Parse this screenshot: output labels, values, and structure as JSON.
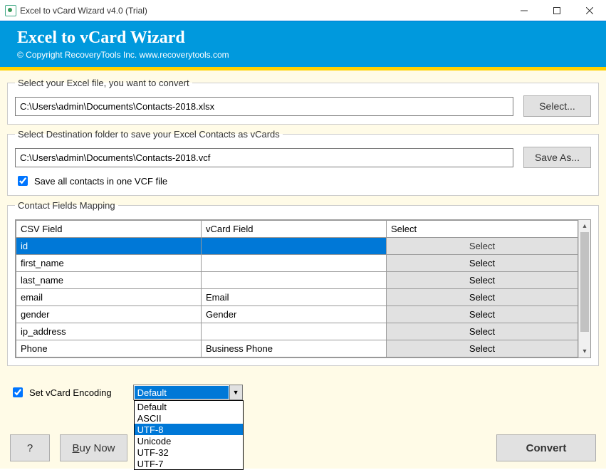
{
  "window": {
    "title": "Excel to vCard Wizard v4.0 (Trial)"
  },
  "banner": {
    "title": "Excel to vCard Wizard",
    "copyright": "© Copyright RecoveryTools Inc. www.recoverytools.com"
  },
  "source": {
    "legend": "Select your Excel file, you want to convert",
    "path": "C:\\Users\\admin\\Documents\\Contacts-2018.xlsx",
    "button": "Select..."
  },
  "destination": {
    "legend": "Select Destination folder to save your Excel Contacts as vCards",
    "path": "C:\\Users\\admin\\Documents\\Contacts-2018.vcf",
    "button": "Save As...",
    "checkbox": "Save all contacts in one VCF file"
  },
  "mapping": {
    "legend": "Contact Fields Mapping",
    "headers": {
      "csv": "CSV Field",
      "vcard": "vCard Field",
      "select": "Select"
    },
    "select_button": "Select",
    "rows": [
      {
        "csv": "id",
        "vcard": "",
        "selected": true
      },
      {
        "csv": "first_name",
        "vcard": ""
      },
      {
        "csv": "last_name",
        "vcard": ""
      },
      {
        "csv": "email",
        "vcard": "Email"
      },
      {
        "csv": "gender",
        "vcard": "Gender"
      },
      {
        "csv": "ip_address",
        "vcard": ""
      },
      {
        "csv": "Phone",
        "vcard": "Business Phone"
      }
    ]
  },
  "encoding": {
    "label": "Set vCard Encoding",
    "selected": "Default",
    "options": [
      "Default",
      "ASCII",
      "UTF-8",
      "Unicode",
      "UTF-32",
      "UTF-7"
    ],
    "highlighted": "UTF-8"
  },
  "footer": {
    "help": "?",
    "buynow_prefix": "B",
    "buynow_rest": "uy Now",
    "convert": "Convert"
  }
}
